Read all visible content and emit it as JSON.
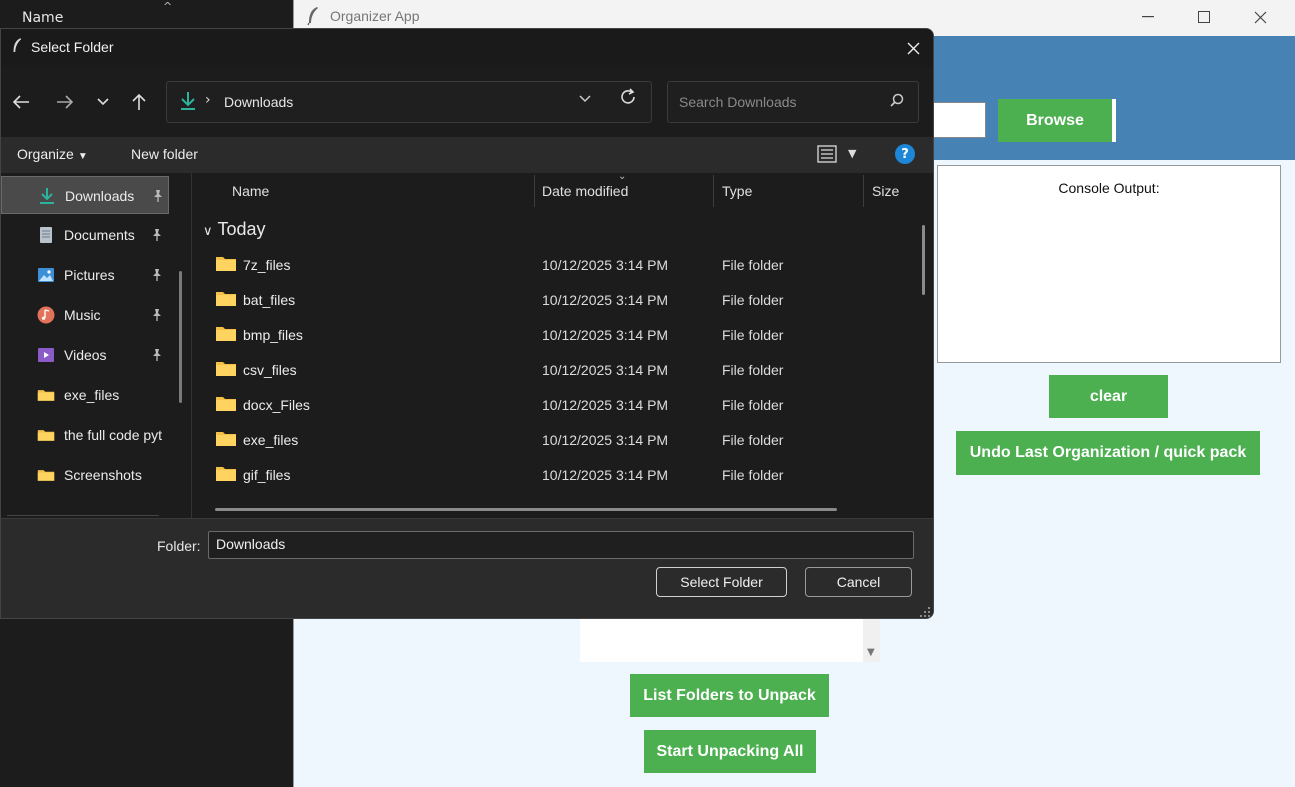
{
  "background_explorer": {
    "column_header": "Name"
  },
  "organizer": {
    "title": "Organizer App",
    "browse_label": "Browse",
    "console_label": "Console Output:",
    "clear_label": "clear",
    "undo_label": "Undo Last Organization / quick pack",
    "list_label": "List Folders to Unpack",
    "start_label": "Start Unpacking All"
  },
  "dialog": {
    "title": "Select Folder",
    "address": {
      "current": "Downloads"
    },
    "search": {
      "placeholder": "Search Downloads"
    },
    "commands": {
      "organize": "Organize",
      "new_folder": "New folder"
    },
    "nav_items": [
      {
        "label": "Downloads",
        "icon": "download-icon",
        "pinned": true
      },
      {
        "label": "Documents",
        "icon": "document-icon",
        "pinned": true
      },
      {
        "label": "Pictures",
        "icon": "pictures-icon",
        "pinned": true
      },
      {
        "label": "Music",
        "icon": "music-icon",
        "pinned": true
      },
      {
        "label": "Videos",
        "icon": "videos-icon",
        "pinned": true
      },
      {
        "label": "exe_files",
        "icon": "folder-icon",
        "pinned": false
      },
      {
        "label": "the full code pyt",
        "icon": "folder-icon",
        "pinned": false
      },
      {
        "label": "Screenshots",
        "icon": "folder-icon",
        "pinned": false
      }
    ],
    "columns": {
      "name": "Name",
      "date": "Date modified",
      "type": "Type",
      "size": "Size"
    },
    "group": "Today",
    "files": [
      {
        "name": "7z_files",
        "date": "10/12/2025 3:14 PM",
        "type": "File folder"
      },
      {
        "name": "bat_files",
        "date": "10/12/2025 3:14 PM",
        "type": "File folder"
      },
      {
        "name": "bmp_files",
        "date": "10/12/2025 3:14 PM",
        "type": "File folder"
      },
      {
        "name": "csv_files",
        "date": "10/12/2025 3:14 PM",
        "type": "File folder"
      },
      {
        "name": "docx_Files",
        "date": "10/12/2025 3:14 PM",
        "type": "File folder"
      },
      {
        "name": "exe_files",
        "date": "10/12/2025 3:14 PM",
        "type": "File folder"
      },
      {
        "name": "gif_files",
        "date": "10/12/2025 3:14 PM",
        "type": "File folder"
      }
    ],
    "footer": {
      "folder_label": "Folder:",
      "folder_value": "Downloads",
      "select_label": "Select Folder",
      "cancel_label": "Cancel"
    }
  },
  "colors": {
    "accent_green": "#4caf50",
    "header_blue": "#4682b4",
    "folder_yellow": "#f4c046",
    "download_teal": "#2bb39b",
    "help_blue": "#1e86d6"
  }
}
